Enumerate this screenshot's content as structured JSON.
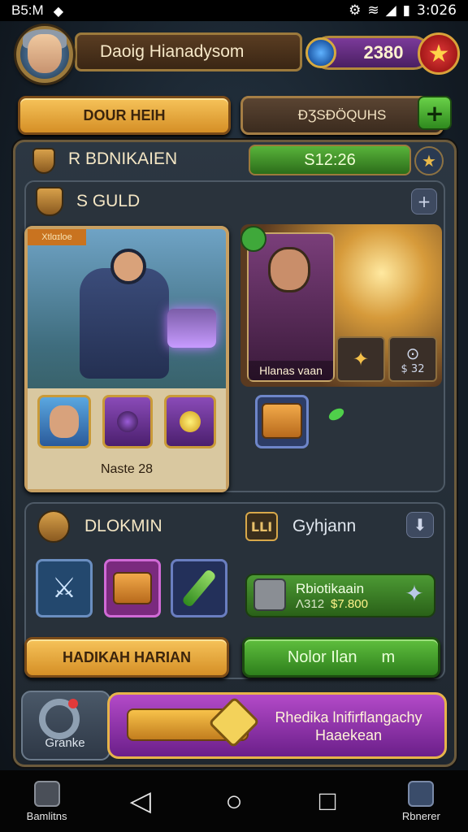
{
  "status_bar": {
    "time": "B5:M",
    "clock": "3:026"
  },
  "profile": {
    "name": "Daoig Hianadysom",
    "currency": "2380"
  },
  "top_buttons": {
    "left": "DOUR HEIH",
    "right": "ÐƷSÐÖQUHS"
  },
  "event": {
    "title": "R BDNIKAIEN",
    "timer": "S12:26"
  },
  "guild": {
    "title": "S GULD",
    "hero_tag": "Xtlɑɪloe",
    "hero_name": "Naste 28",
    "villain_name": "Hlanas vaan",
    "tile_value": "$ 32"
  },
  "dungeon": {
    "title": "DLOKMIN",
    "rune": "LLI",
    "label": "Gyhjann",
    "reward_title": "Rbiotikaain",
    "reward_sub": "Ʌ312",
    "reward_value": "$7.800",
    "button_left": "HADIKAH HARIAN",
    "button_right": "Nolor Ilan",
    "button_right_suffix": "m"
  },
  "bottom": {
    "settings_label": "Granke",
    "promo_line1": "Rhedika lnifirflangachy",
    "promo_line2": "Haaekean"
  },
  "navbar": {
    "left_label": "Bamlitns",
    "right_label": "Rbnerer"
  },
  "colors": {
    "gold": "#f6c35a",
    "green": "#5fbf3e",
    "purple": "#7b3a9a",
    "red": "#e23a3a"
  }
}
